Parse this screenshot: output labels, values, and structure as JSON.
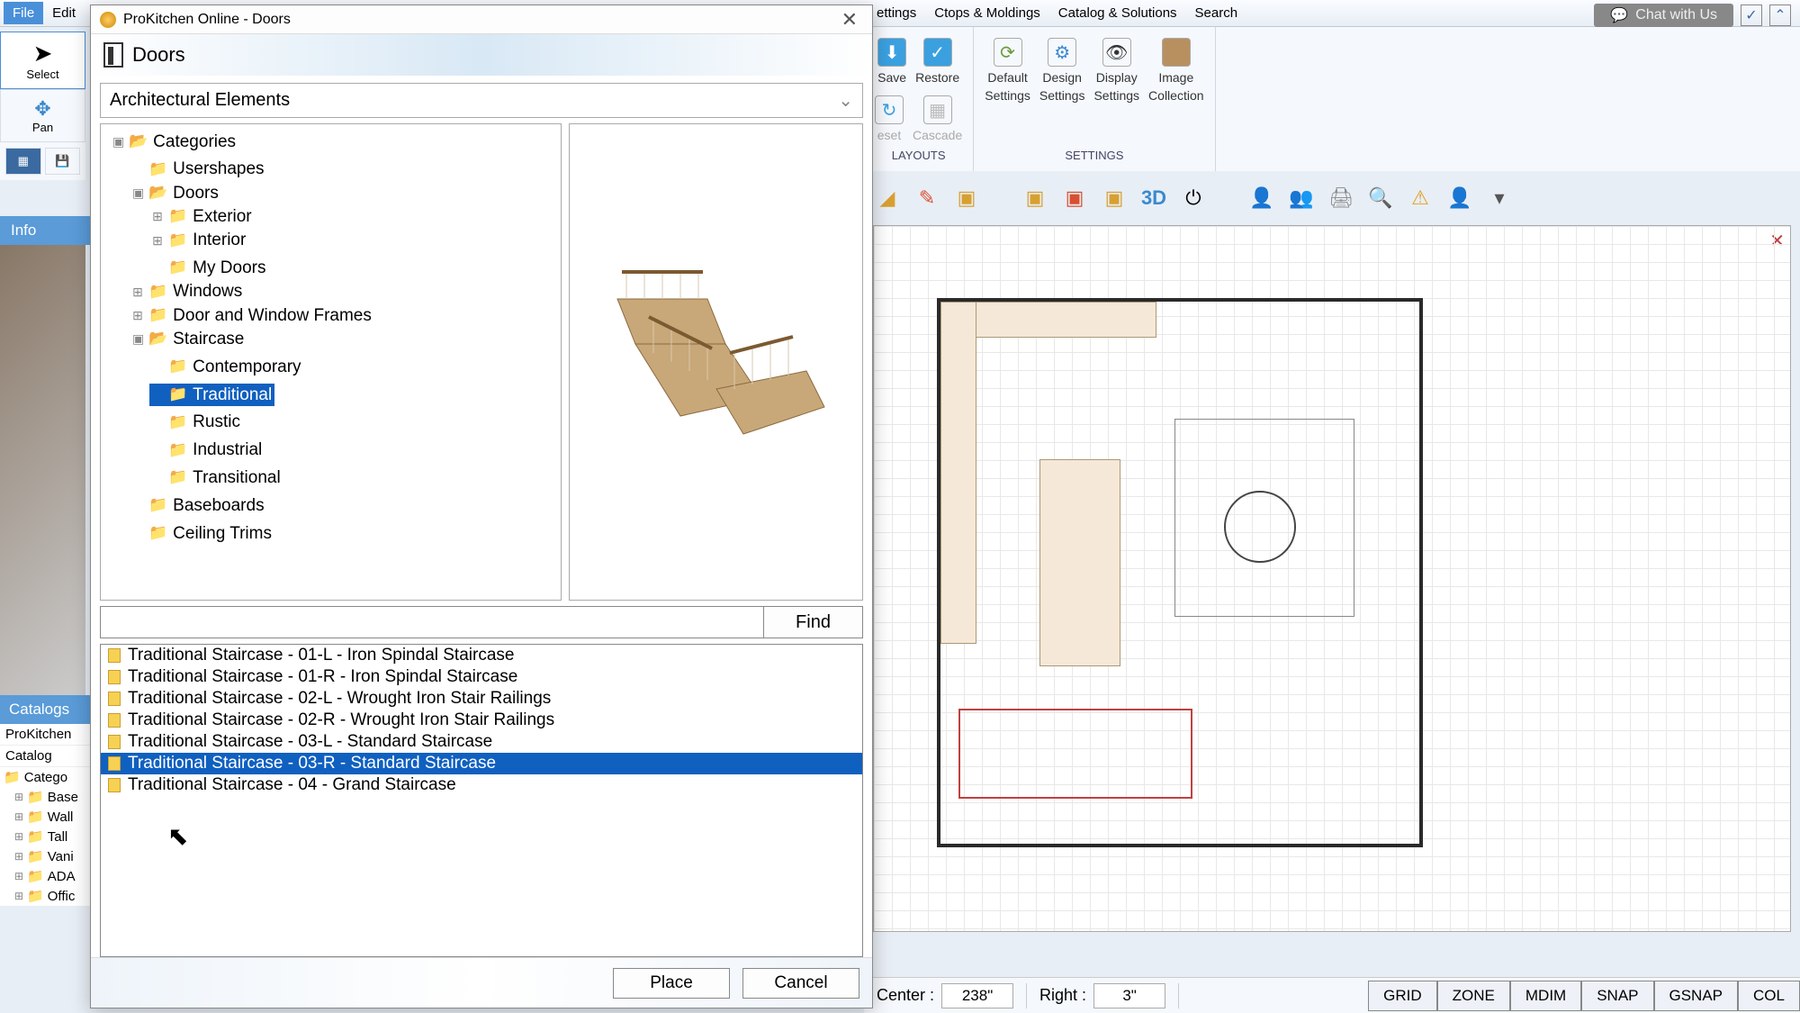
{
  "app": {
    "title": "ProKitchen Online - Doors"
  },
  "menubar": {
    "file": "File",
    "edit": "Edit",
    "settings": "ettings",
    "ctops": "Ctops & Moldings",
    "catalog": "Catalog & Solutions",
    "search": "Search"
  },
  "chat": {
    "label": "Chat with Us"
  },
  "ribbon": {
    "save": "Save",
    "restore": "Restore",
    "reset": "eset",
    "cascade": "Cascade",
    "defaultSettings1": "Default",
    "defaultSettings2": "Settings",
    "designSettings1": "Design",
    "designSettings2": "Settings",
    "displaySettings1": "Display",
    "displaySettings2": "Settings",
    "imageCollection1": "Image",
    "imageCollection2": "Collection",
    "layoutsLabel": "LAYOUTS",
    "settingsLabel": "SETTINGS",
    "threeD": "3D"
  },
  "tools": {
    "select": "Select",
    "pan": "Pan"
  },
  "leftpanel": {
    "info": "Info",
    "catalogs": "Catalogs",
    "prokitchen": "ProKitchen",
    "catalog": "Catalog",
    "categ": "Catego",
    "items": [
      "Base",
      "Wall",
      "Tall",
      "Vani",
      "ADA",
      "Offic"
    ]
  },
  "dialog": {
    "title": "Doors",
    "dropdown": "Architectural Elements",
    "tree": {
      "root": "Categories",
      "usershapes": "Usershapes",
      "doors": "Doors",
      "exterior": "Exterior",
      "interior": "Interior",
      "mydoors": "My Doors",
      "windows": "Windows",
      "frames": "Door and Window Frames",
      "staircase": "Staircase",
      "contemporary": "Contemporary",
      "traditional": "Traditional",
      "rustic": "Rustic",
      "industrial": "Industrial",
      "transitional": "Transitional",
      "baseboards": "Baseboards",
      "ceiling": "Ceiling Trims"
    },
    "find": "Find",
    "results": [
      "Traditional Staircase - 01-L - Iron Spindal Staircase",
      "Traditional Staircase - 01-R - Iron Spindal Staircase",
      "Traditional Staircase - 02-L - Wrought Iron Stair Railings",
      "Traditional Staircase - 02-R - Wrought Iron Stair Railings",
      "Traditional Staircase - 03-L - Standard Staircase",
      "Traditional Staircase - 03-R - Standard Staircase",
      "Traditional Staircase - 04 - Grand Staircase"
    ],
    "selectedResult": 5,
    "place": "Place",
    "cancel": "Cancel"
  },
  "status": {
    "centerLabel": "Center :",
    "centerVal": "238\"",
    "rightLabel": "Right :",
    "rightVal": "3\"",
    "grid": "GRID",
    "zone": "ZONE",
    "mdim": "MDIM",
    "snap": "SNAP",
    "gsnap": "GSNAP",
    "col": "COL"
  }
}
